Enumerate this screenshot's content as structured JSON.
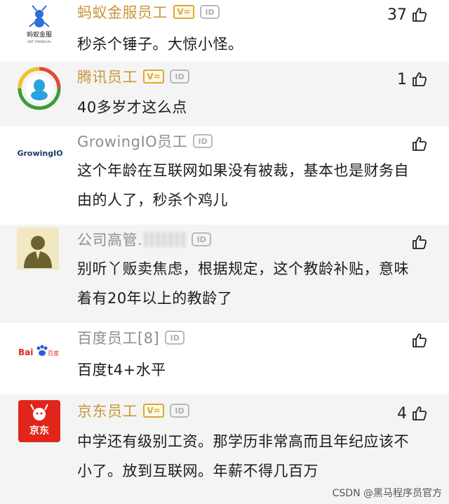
{
  "comments": [
    {
      "user": "蚂蚁金服员工",
      "verified": "V=",
      "id_badge": "ID",
      "likes": "37",
      "text": "秒杀个锤子。大惊小怪。",
      "avatar_label": "蚂蚁金服",
      "avatar_sub": "ANT FINANCIAL"
    },
    {
      "user": "腾讯员工",
      "verified": "V=",
      "id_badge": "ID",
      "likes": "1",
      "text": "40多岁才这么点"
    },
    {
      "user": "GrowingIO员工",
      "id_badge": "ID",
      "likes": "",
      "text": "这个年龄在互联网如果没有被裁，基本也是财务自由的人了，秒杀个鸡儿",
      "avatar_label": "GrowingIO"
    },
    {
      "user": "公司高管.",
      "id_badge": "ID",
      "likes": "",
      "text": "别听丫贩卖焦虑，根据规定，这个教龄补贴，意味着有20年以上的教龄了"
    },
    {
      "user": "百度员工[8]",
      "id_badge": "ID",
      "likes": "",
      "text": "百度t4+水平",
      "avatar_label_a": "Bai",
      "avatar_label_b": "百度"
    },
    {
      "user": "京东员工",
      "verified": "V=",
      "id_badge": "ID",
      "likes": "4",
      "text": "中学还有级别工资。那学历非常高而且年纪应该不小了。放到互联网。年薪不得几百万",
      "avatar_label": "京东"
    }
  ],
  "watermark": "CSDN @黑马程序员官方"
}
